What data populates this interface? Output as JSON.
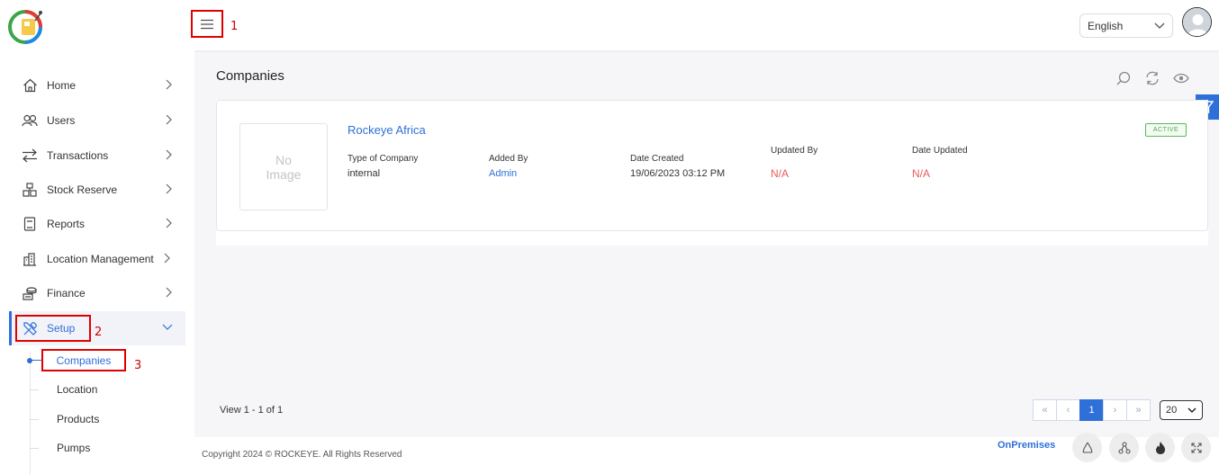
{
  "header": {
    "menu_annotation": "1",
    "language": "English"
  },
  "sidebar": {
    "items": [
      {
        "label": "Home",
        "icon": "home-icon"
      },
      {
        "label": "Users",
        "icon": "users-icon"
      },
      {
        "label": "Transactions",
        "icon": "transfer-arrows-icon"
      },
      {
        "label": "Stock Reserve",
        "icon": "boxes-icon"
      },
      {
        "label": "Reports",
        "icon": "report-book-icon"
      },
      {
        "label": "Location Management",
        "icon": "building-icon"
      },
      {
        "label": "Finance",
        "icon": "coins-icon"
      },
      {
        "label": "Setup",
        "icon": "tools-icon"
      }
    ],
    "setup_annotation": "2",
    "sub_items": [
      "Companies",
      "Location",
      "Products",
      "Pumps"
    ],
    "companies_annotation": "3"
  },
  "main": {
    "title": "Companies",
    "card": {
      "image_placeholder": "No Image",
      "company_name": "Rockeye Africa",
      "status": "ACTIVE",
      "fields": [
        {
          "label": "Type of Company",
          "value": "internal"
        },
        {
          "label": "Added By",
          "value": "Admin"
        },
        {
          "label": "Date Created",
          "value": "19/06/2023 03:12 PM"
        },
        {
          "label": "Updated By",
          "value": "N/A"
        },
        {
          "label": "Date Updated",
          "value": "N/A"
        }
      ]
    },
    "view_count": "View 1 - 1 of 1",
    "pagination": {
      "first": "«",
      "prev": "‹",
      "current": "1",
      "next": "›",
      "last": "»",
      "per_page": "20"
    }
  },
  "footer": {
    "copyright": "Copyright 2024 © ROCKEYE. All Rights Reserved",
    "mode": "OnPremises"
  },
  "colors": {
    "accent": "#2f6fd8",
    "annotation_red": "#e00000",
    "na_red": "#e85c5c",
    "active_green": "#4cae4c"
  }
}
